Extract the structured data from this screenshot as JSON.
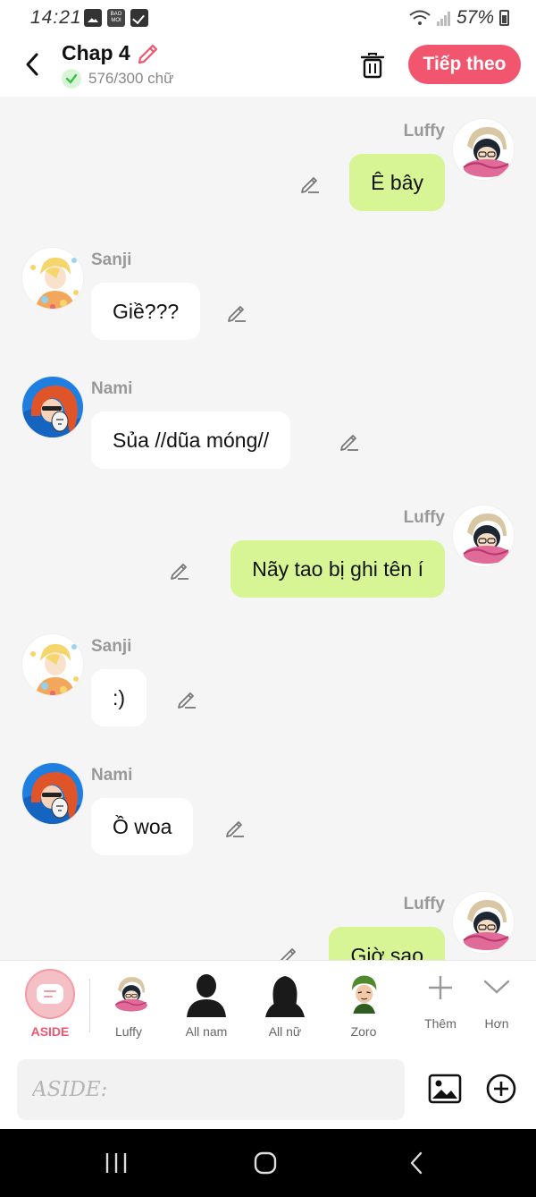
{
  "status_bar": {
    "time": "14:21",
    "battery": "57%"
  },
  "header": {
    "title": "Chap 4",
    "word_count": "576/300 chữ",
    "next_button": "Tiếp theo"
  },
  "messages": [
    {
      "sender": "Luffy",
      "text": "Ê bây",
      "side": "me"
    },
    {
      "sender": "Sanji",
      "text": "Giề???",
      "side": "other"
    },
    {
      "sender": "Nami",
      "text": "Sủa //dũa móng//",
      "side": "other"
    },
    {
      "sender": "Luffy",
      "text": "Nãy tao bị ghi tên í",
      "side": "me"
    },
    {
      "sender": "Sanji",
      "text": ":)",
      "side": "other"
    },
    {
      "sender": "Nami",
      "text": "Ồ woa",
      "side": "other"
    },
    {
      "sender": "Luffy",
      "text": "Giờ sao",
      "side": "me"
    }
  ],
  "character_bar": {
    "aside": "ASIDE",
    "luffy": "Luffy",
    "all_male": "All nam",
    "all_female": "All nữ",
    "zoro": "Zoro",
    "add": "Thêm",
    "more": "Hơn"
  },
  "input": {
    "placeholder": "ASIDE:"
  },
  "colors": {
    "accent": "#f2566f",
    "my_bubble": "#d7f595",
    "other_bubble": "#ffffff",
    "background": "#f5f5f5"
  },
  "icons": [
    "back-icon",
    "pencil-icon",
    "check-icon",
    "trash-icon",
    "edit-icon",
    "plus-icon",
    "chevron-down-icon",
    "image-icon",
    "add-circle-icon",
    "recents-icon",
    "home-icon",
    "nav-back-icon"
  ]
}
